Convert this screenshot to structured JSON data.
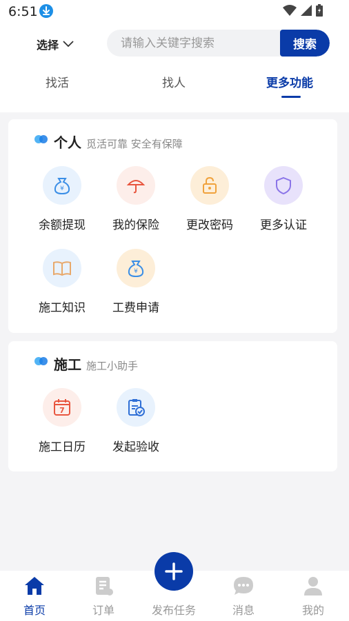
{
  "status_bar": {
    "time": "6:51"
  },
  "header": {
    "select_label": "选择",
    "search_placeholder": "请输入关键字搜索",
    "search_button": "搜索",
    "tabs": [
      {
        "label": "找活"
      },
      {
        "label": "找人"
      },
      {
        "label": "更多功能"
      }
    ]
  },
  "sections": [
    {
      "title": "个人",
      "subtitle": "觅活可靠 安全有保障",
      "items": [
        {
          "label": "余额提现",
          "icon": "money-bag-icon"
        },
        {
          "label": "我的保险",
          "icon": "umbrella-icon"
        },
        {
          "label": "更改密码",
          "icon": "lock-icon"
        },
        {
          "label": "更多认证",
          "icon": "shield-icon"
        },
        {
          "label": "施工知识",
          "icon": "book-icon"
        },
        {
          "label": "工费申请",
          "icon": "money-bag-icon"
        }
      ]
    },
    {
      "title": "施工",
      "subtitle": "施工小助手",
      "items": [
        {
          "label": "施工日历",
          "icon": "calendar-icon",
          "badge": "7"
        },
        {
          "label": "发起验收",
          "icon": "clipboard-check-icon"
        }
      ]
    }
  ],
  "tabbar": {
    "items": [
      {
        "label": "首页",
        "icon": "home-icon"
      },
      {
        "label": "订单",
        "icon": "order-icon"
      },
      {
        "label": "发布任务",
        "icon": "plus-icon"
      },
      {
        "label": "消息",
        "icon": "chat-icon"
      },
      {
        "label": "我的",
        "icon": "user-icon"
      }
    ]
  },
  "colors": {
    "primary": "#0a3ba8",
    "background": "#f4f4f6",
    "card": "#ffffff"
  }
}
